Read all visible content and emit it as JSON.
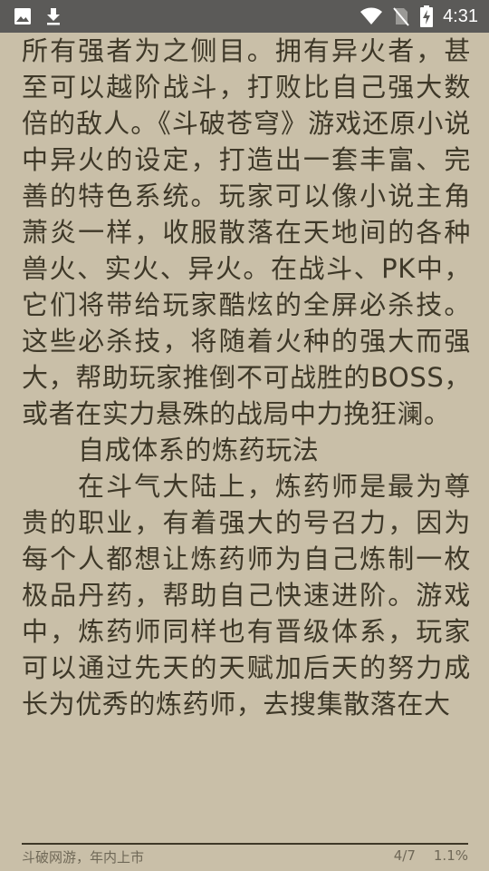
{
  "status_bar": {
    "left_icons": [
      "image-icon",
      "download-icon"
    ],
    "right_icons": [
      "wifi-icon",
      "no-sim-icon",
      "battery-charging-icon"
    ],
    "time": "4:31"
  },
  "content": {
    "paragraphs": [
      {
        "text": "所有强者为之侧目。拥有异火者，甚至可以越阶战斗，打败比自己强大数倍的敌人。《斗破苍穹》游戏还原小说中异火的设定，打造出一套丰富、完善的特色系统。玩家可以像小说主角萧炎一样，收服散落在天地间的各种兽火、实火、异火。在战斗、PK中，它们将带给玩家酷炫的全屏必杀技。这些必杀技，将随着火种的强大而强大，帮助玩家推倒不可战胜的BOSS，或者在实力悬殊的战局中力挽狂澜。",
        "indent": false
      },
      {
        "text": "自成体系的炼药玩法",
        "indent": true
      },
      {
        "text": "在斗气大陆上，炼药师是最为尊贵的职业，有着强大的号召力，因为每个人都想让炼药师为自己炼制一枚极品丹药，帮助自己快速进阶。游戏中，炼药师同样也有晋级体系，玩家可以通过先天的天赋加后天的努力成长为优秀的炼药师，去搜集散落在大",
        "indent": true
      }
    ]
  },
  "footer": {
    "chapter_title": "斗破网游，年内上市",
    "page": "4/7",
    "progress": "1.1%"
  }
}
